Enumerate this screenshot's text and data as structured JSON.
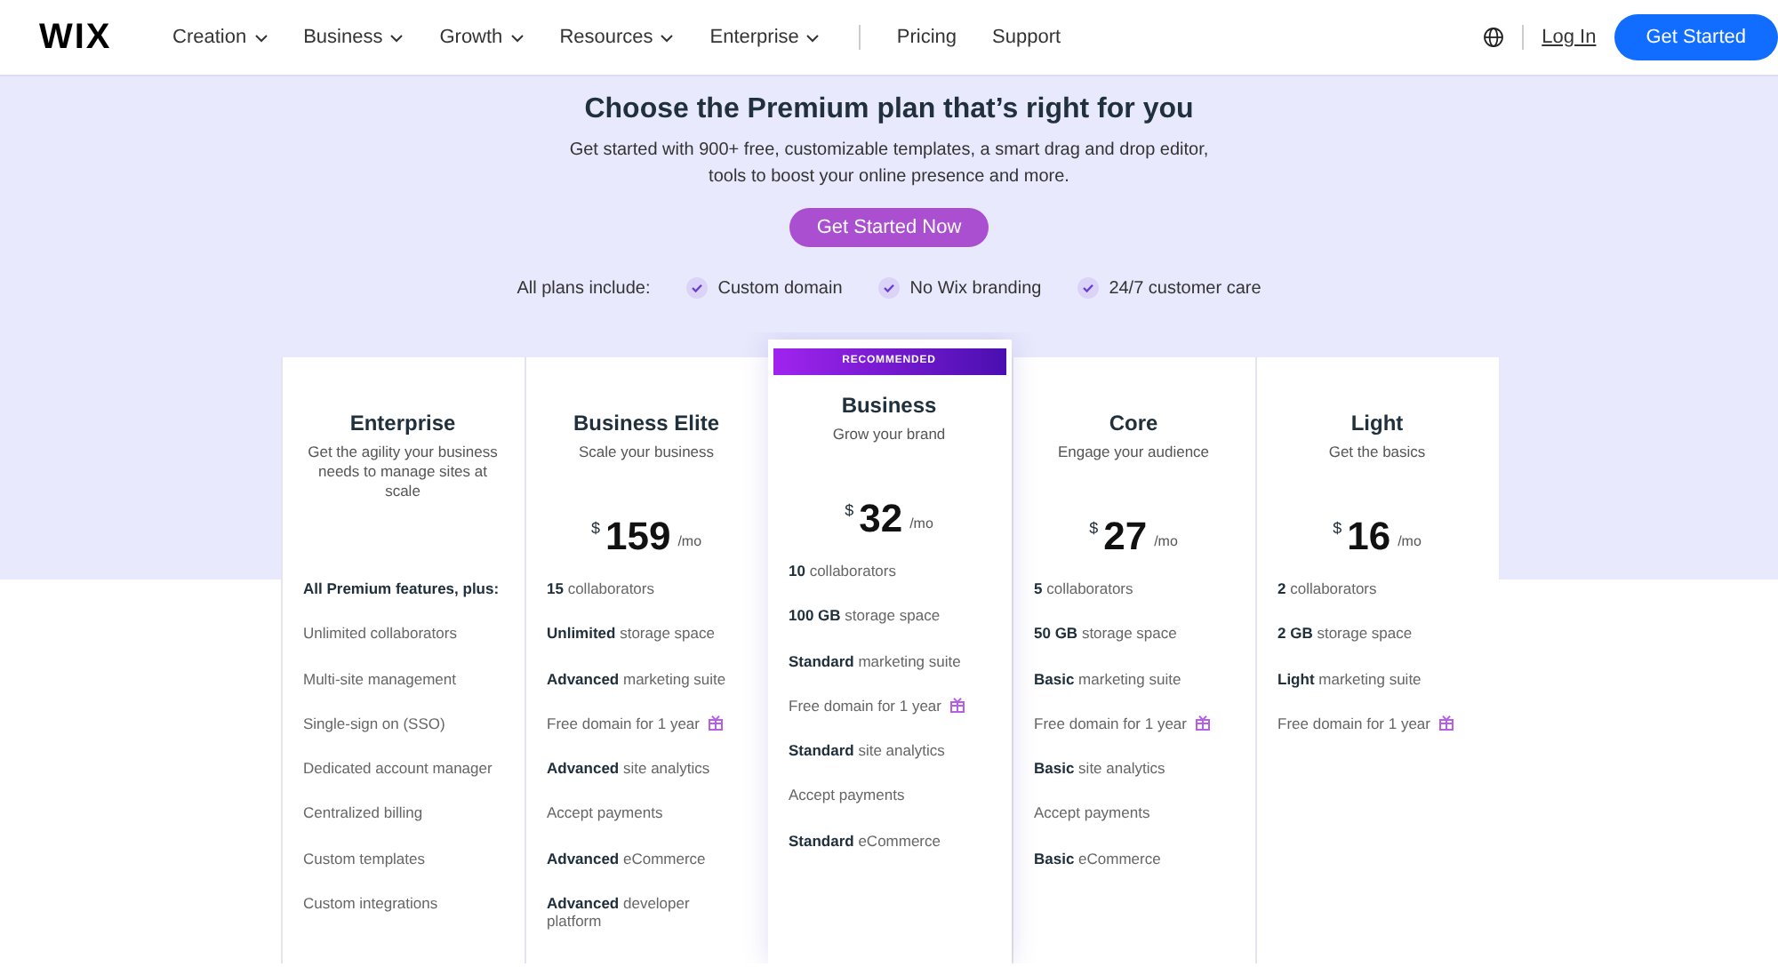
{
  "header": {
    "logo": "WIX",
    "nav": [
      {
        "label": "Creation",
        "has_menu": true
      },
      {
        "label": "Business",
        "has_menu": true
      },
      {
        "label": "Growth",
        "has_menu": true
      },
      {
        "label": "Resources",
        "has_menu": true
      },
      {
        "label": "Enterprise",
        "has_menu": true
      },
      {
        "label": "Pricing",
        "has_menu": false
      },
      {
        "label": "Support",
        "has_menu": false
      }
    ],
    "login": "Log In",
    "cta": "Get Started"
  },
  "hero": {
    "title": "Choose the Premium plan that’s right for you",
    "description": "Get started with 900+ free, customizable templates, a smart drag and drop editor, tools to boost your online presence and more.",
    "button": "Get Started Now",
    "includes_label": "All plans include:",
    "includes": [
      "Custom domain",
      "No Wix branding",
      "24/7 customer care"
    ]
  },
  "plans": [
    {
      "name": "Enterprise",
      "tagline": "Get the agility your business needs to manage sites at scale",
      "recommended": false,
      "features": [
        {
          "text": "All Premium features, plus:",
          "kind": "heading",
          "gift": false
        },
        {
          "text": "Unlimited collaborators",
          "kind": "item",
          "gift": false
        },
        {
          "text": "Multi-site management",
          "kind": "item",
          "gift": false
        },
        {
          "text": "Single-sign on (SSO)",
          "kind": "item",
          "gift": false
        },
        {
          "text": "Dedicated account manager",
          "kind": "item",
          "gift": false
        },
        {
          "text": "Centralized billing",
          "kind": "item",
          "gift": false
        },
        {
          "text": "Custom templates",
          "kind": "item",
          "gift": false
        },
        {
          "text": "Custom integrations",
          "kind": "item",
          "gift": false
        }
      ]
    },
    {
      "name": "Business Elite",
      "tagline": "Scale your business",
      "recommended": false,
      "price": {
        "currency": "$",
        "amount": "159",
        "period": "/mo"
      },
      "features": [
        {
          "text": "**15** collaborators",
          "kind": "item",
          "gift": false
        },
        {
          "text": "**Unlimited** storage space",
          "kind": "item",
          "gift": false
        },
        {
          "text": "**Advanced** marketing suite",
          "kind": "item",
          "gift": false
        },
        {
          "text": "Free domain for 1 year",
          "kind": "item",
          "gift": true
        },
        {
          "text": "**Advanced** site analytics",
          "kind": "item",
          "gift": false
        },
        {
          "text": "Accept payments",
          "kind": "item",
          "gift": false
        },
        {
          "text": "**Advanced** eCommerce",
          "kind": "item",
          "gift": false
        },
        {
          "text": "**Advanced** developer platform",
          "kind": "item",
          "gift": false
        }
      ]
    },
    {
      "name": "Business",
      "tagline": "Grow your brand",
      "recommended": true,
      "badge": "RECOMMENDED",
      "price": {
        "currency": "$",
        "amount": "32",
        "period": "/mo"
      },
      "features": [
        {
          "text": "**10** collaborators",
          "kind": "item",
          "gift": false
        },
        {
          "text": "**100 GB** storage space",
          "kind": "item",
          "gift": false
        },
        {
          "text": "**Standard** marketing suite",
          "kind": "item",
          "gift": false
        },
        {
          "text": "Free domain for 1 year",
          "kind": "item",
          "gift": true
        },
        {
          "text": "**Standard** site analytics",
          "kind": "item",
          "gift": false
        },
        {
          "text": "Accept payments",
          "kind": "item",
          "gift": false
        },
        {
          "text": "**Standard** eCommerce",
          "kind": "item",
          "gift": false
        }
      ]
    },
    {
      "name": "Core",
      "tagline": "Engage your audience",
      "recommended": false,
      "price": {
        "currency": "$",
        "amount": "27",
        "period": "/mo"
      },
      "features": [
        {
          "text": "**5** collaborators",
          "kind": "item",
          "gift": false
        },
        {
          "text": "**50 GB** storage space",
          "kind": "item",
          "gift": false
        },
        {
          "text": "**Basic** marketing suite",
          "kind": "item",
          "gift": false
        },
        {
          "text": "Free domain for 1 year",
          "kind": "item",
          "gift": true
        },
        {
          "text": "**Basic** site analytics",
          "kind": "item",
          "gift": false
        },
        {
          "text": "Accept payments",
          "kind": "item",
          "gift": false
        },
        {
          "text": "**Basic** eCommerce",
          "kind": "item",
          "gift": false
        }
      ]
    },
    {
      "name": "Light",
      "tagline": "Get the basics",
      "recommended": false,
      "price": {
        "currency": "$",
        "amount": "16",
        "period": "/mo"
      },
      "features": [
        {
          "text": "**2** collaborators",
          "kind": "item",
          "gift": false
        },
        {
          "text": "**2 GB** storage space",
          "kind": "item",
          "gift": false
        },
        {
          "text": "**Light** marketing suite",
          "kind": "item",
          "gift": false
        },
        {
          "text": "Free domain for 1 year",
          "kind": "item",
          "gift": true
        }
      ]
    }
  ]
}
